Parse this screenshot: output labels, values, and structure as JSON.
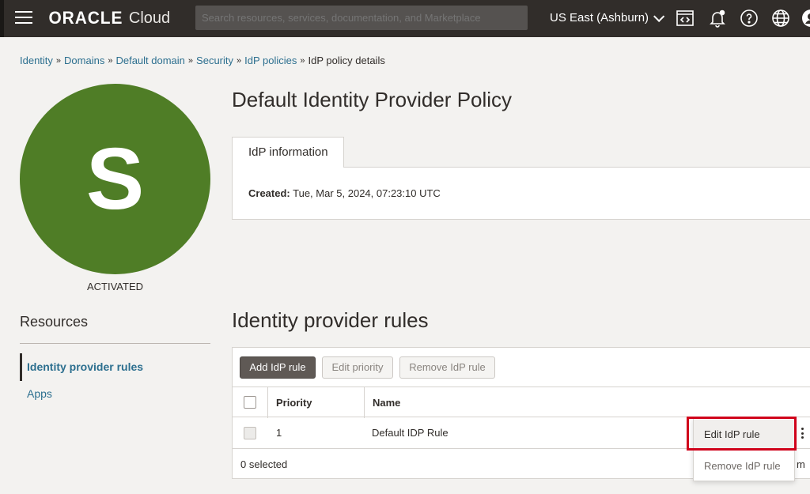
{
  "header": {
    "logo_brand": "ORACLE",
    "logo_product": "Cloud",
    "search_placeholder": "Search resources, services, documentation, and Marketplace",
    "region": "US East (Ashburn)",
    "icons": [
      "hamburger-icon",
      "code-editor-icon",
      "notification-bell-icon",
      "help-icon",
      "language-globe-icon",
      "profile-icon"
    ]
  },
  "breadcrumb": {
    "items": [
      "Identity",
      "Domains",
      "Default domain",
      "Security",
      "IdP policies"
    ],
    "current": "IdP policy details"
  },
  "avatar": {
    "letter": "S",
    "status": "ACTIVATED",
    "color": "#4f7d26"
  },
  "page": {
    "title": "Default Identity Provider Policy",
    "tab_label": "IdP information",
    "created_label": "Created:",
    "created_value": "Tue, Mar 5, 2024, 07:23:10 UTC"
  },
  "resources": {
    "title": "Resources",
    "items": [
      "Identity provider rules",
      "Apps"
    ]
  },
  "rules": {
    "title": "Identity provider rules",
    "buttons": {
      "add": "Add IdP rule",
      "edit_priority": "Edit priority",
      "remove": "Remove IdP rule"
    },
    "columns": [
      "Priority",
      "Name"
    ],
    "rows": [
      {
        "priority": "1",
        "name": "Default IDP Rule"
      }
    ],
    "selected_count": "0 selected",
    "pager_fragment": "m"
  },
  "context_menu": {
    "items": [
      "Edit IdP rule",
      "Remove IdP rule"
    ]
  },
  "colors": {
    "topbar": "#312d2a",
    "link": "#2c6f8f",
    "highlight": "#d0021b"
  }
}
